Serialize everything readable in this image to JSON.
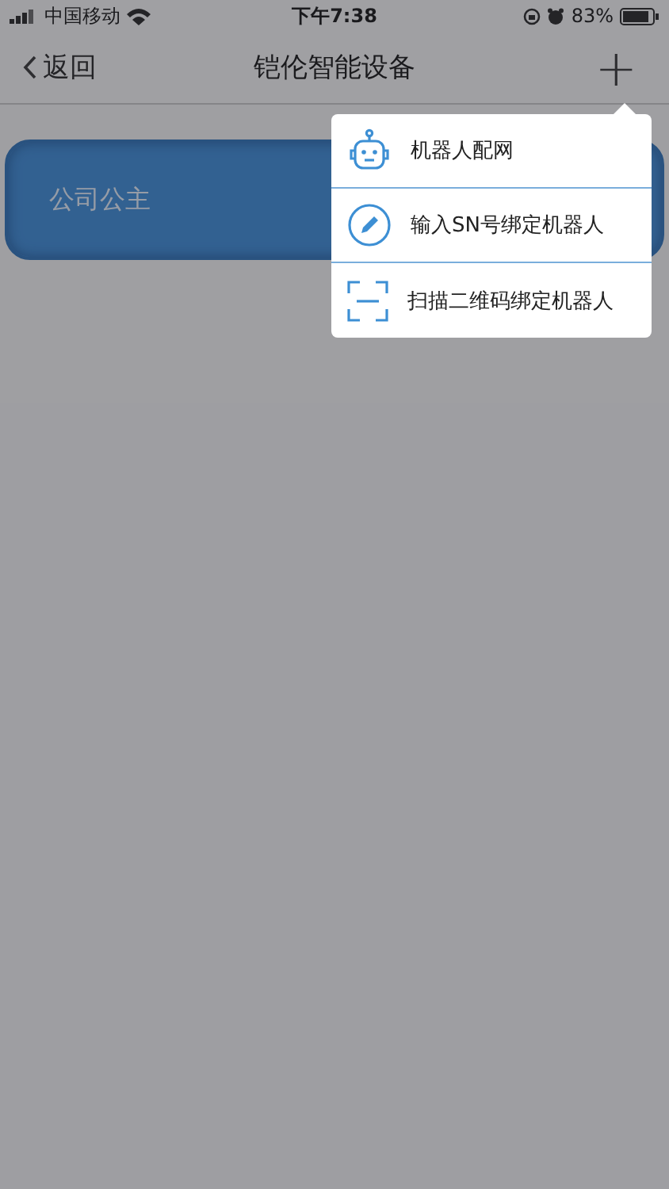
{
  "status_bar": {
    "carrier": "中国移动",
    "time": "下午7:38",
    "battery": "83%"
  },
  "nav": {
    "back": "返回",
    "title": "铠伦智能设备",
    "add": "+"
  },
  "devices": [
    {
      "name": "公司公主"
    }
  ],
  "menu": [
    {
      "kind": "robot",
      "label": "机器人配网"
    },
    {
      "kind": "pencil",
      "label": "输入SN号绑定机器人"
    },
    {
      "kind": "scan",
      "label": "扫描二维码绑定机器人"
    }
  ]
}
